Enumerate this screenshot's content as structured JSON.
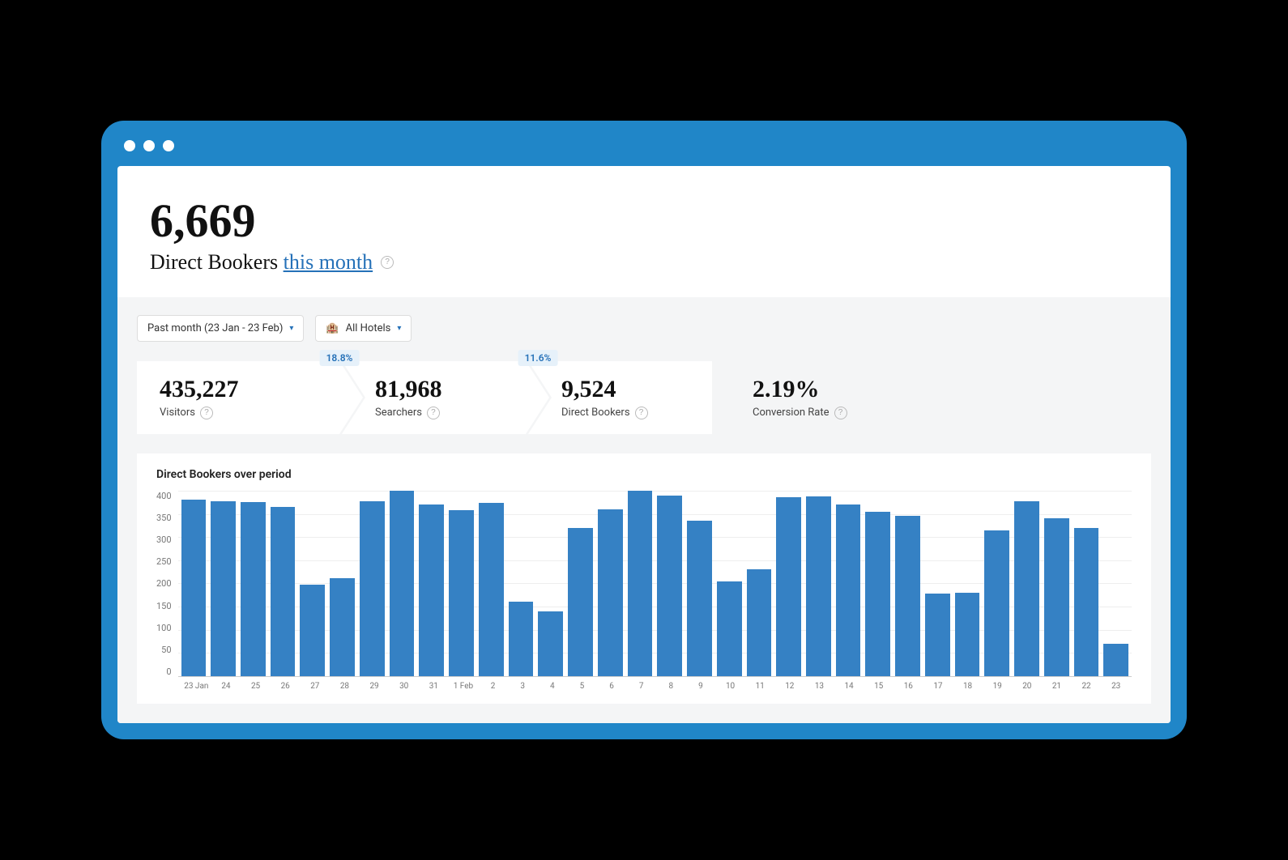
{
  "header": {
    "big_number": "6,669",
    "subtitle_prefix": "Direct Bookers ",
    "subtitle_link": "this month"
  },
  "filters": {
    "date_range": "Past month (23 Jan - 23 Feb)",
    "hotels": "All Hotels"
  },
  "funnel": {
    "badge1": "18.8%",
    "badge2": "11.6%",
    "cards": [
      {
        "value": "435,227",
        "label": "Visitors"
      },
      {
        "value": "81,968",
        "label": "Searchers"
      },
      {
        "value": "9,524",
        "label": "Direct Bookers"
      },
      {
        "value": "2.19%",
        "label": "Conversion Rate"
      }
    ]
  },
  "chart_data": {
    "type": "bar",
    "title": "Direct Bookers over period",
    "xlabel": "",
    "ylabel": "",
    "ylim": [
      0,
      400
    ],
    "y_ticks": [
      400,
      350,
      300,
      250,
      200,
      150,
      100,
      50,
      0
    ],
    "categories": [
      "23 Jan",
      "24",
      "25",
      "26",
      "27",
      "28",
      "29",
      "30",
      "31",
      "1 Feb",
      "2",
      "3",
      "4",
      "5",
      "6",
      "7",
      "8",
      "9",
      "10",
      "11",
      "12",
      "13",
      "14",
      "15",
      "16",
      "17",
      "18",
      "19",
      "20",
      "21",
      "22",
      "23"
    ],
    "values": [
      380,
      378,
      375,
      365,
      198,
      212,
      378,
      400,
      370,
      358,
      374,
      160,
      140,
      320,
      360,
      400,
      390,
      335,
      205,
      230,
      385,
      388,
      370,
      355,
      345,
      178,
      180,
      315,
      378,
      340,
      320,
      70
    ]
  },
  "colors": {
    "frame": "#2086c8",
    "bar": "#3581c4",
    "link": "#2571b8"
  }
}
